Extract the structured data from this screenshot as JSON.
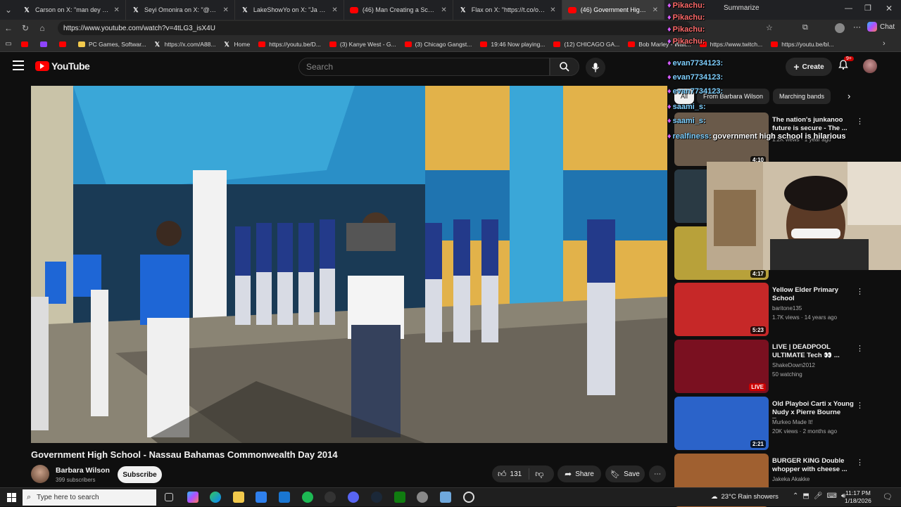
{
  "browser": {
    "tabs": [
      {
        "label": "Carson on X: \"man dey cookin @a",
        "icon": "x-icon"
      },
      {
        "label": "Seyi Omonira on X: \"@DKSportsb",
        "icon": "x-icon"
      },
      {
        "label": "LakeShowYo on X: \"Ja Morant pull",
        "icon": "x-icon"
      },
      {
        "label": "(46) Man Creating a Scene at Sea",
        "icon": "youtube-icon"
      },
      {
        "label": "Flax on X: \"https://t.co/oP7OCupm",
        "icon": "x-icon"
      },
      {
        "label": "(46) Government High Schoo",
        "icon": "youtube-icon"
      }
    ],
    "url": "https://www.youtube.com/watch?v=4tLG3_isX4U",
    "summarize_label": "Summarize",
    "chat_label": "Chat",
    "bookmarks": [
      {
        "label": "",
        "icon": "youtube-icon"
      },
      {
        "label": "",
        "icon": "purple-icon"
      },
      {
        "label": "",
        "icon": "youtube-icon"
      },
      {
        "label": "PC Games, Softwar...",
        "icon": "folder-icon"
      },
      {
        "label": "https://x.com/A88...",
        "icon": "x-icon"
      },
      {
        "label": "Home",
        "icon": "x-icon"
      },
      {
        "label": "https://youtu.be/D...",
        "icon": "youtube-icon"
      },
      {
        "label": "(3) Kanye West - G...",
        "icon": "youtube-icon"
      },
      {
        "label": "(3) Chicago Gangst...",
        "icon": "youtube-icon"
      },
      {
        "label": "19:46 Now playing...",
        "icon": "youtube-icon"
      },
      {
        "label": "(12) CHICAGO GA...",
        "icon": "youtube-icon"
      },
      {
        "label": "Bob Marley - Wait...",
        "icon": "youtube-icon"
      },
      {
        "label": "https://www.twitch...",
        "icon": "youtube-icon"
      },
      {
        "label": "https://youtu.be/bl...",
        "icon": "youtube-icon"
      }
    ]
  },
  "youtube": {
    "logo_text": "YouTube",
    "search_placeholder": "Search",
    "create_label": "Create",
    "notification_badge": "9+",
    "video_title": "Government High School - Nassau Bahamas Commonwealth Day 2014",
    "channel_name": "Barbara Wilson",
    "subscribers": "399 subscribers",
    "subscribe_label": "Subscribe",
    "likes": "131",
    "share_label": "Share",
    "save_label": "Save",
    "chips": [
      "All",
      "From Barbara Wilson",
      "Marching bands"
    ],
    "recommendations": [
      {
        "title": "The nation's junkanoo future is secure - The ...",
        "channel": "",
        "meta": "1.2K views · 1 year ago",
        "duration": "4:10",
        "color": "#6a5a4a"
      },
      {
        "title": "",
        "channel": "",
        "meta": "",
        "duration": "",
        "color": "#2a3a44"
      },
      {
        "title": "",
        "channel": "",
        "meta": "",
        "duration": "4:17",
        "color": "#b8a13a"
      },
      {
        "title": "Yellow Elder Primary School",
        "channel": "baritone135",
        "meta": "1.7K views · 14 years ago",
        "duration": "5:23",
        "color": "#c62828"
      },
      {
        "title": "LIVE | DEADPOOL ULTIMATE Tech 👀 ...",
        "channel": "ShakeDown2012",
        "meta": "50 watching",
        "duration": "LIVE",
        "color": "#7a1020"
      },
      {
        "title": "Old Playboi Carti x Young Nudy x Pierre Bourne Typ...",
        "channel": "Murkeo Made It!",
        "meta": "20K views · 2 months ago",
        "duration": "2:21",
        "color": "#2b63c9"
      },
      {
        "title": "BURGER KING Double whopper with cheese ...",
        "channel": "Jakeka Akakke",
        "meta": "",
        "duration": "",
        "color": "#a06030"
      }
    ]
  },
  "chat_overlay": [
    {
      "user": "Pikachu:",
      "text": "",
      "color": "#ff6a6a"
    },
    {
      "user": "Pikachu:",
      "text": "",
      "color": "#ff6a6a"
    },
    {
      "user": "Pikachu:",
      "text": "",
      "color": "#ff6a6a"
    },
    {
      "user": "Pikachu:",
      "text": "",
      "color": "#ff6a6a"
    },
    {
      "user": "evan7734123:",
      "text": "",
      "color": "#7fd0ff"
    },
    {
      "user": "evan7734123:",
      "text": "",
      "color": "#7fd0ff"
    },
    {
      "user": "evan7734123:",
      "text": "",
      "color": "#7fd0ff"
    },
    {
      "user": "saami_s:",
      "text": "",
      "color": "#7fd0ff"
    },
    {
      "user": "saami_s:",
      "text": "",
      "color": "#7fd0ff"
    },
    {
      "user": "realfiness:",
      "text": "government high school is hilarious",
      "color": "#7fd0ff"
    }
  ],
  "taskbar": {
    "search_placeholder": "Type here to search",
    "weather": "23°C  Rain showers",
    "time": "11:17 PM",
    "date": "1/18/2026"
  }
}
